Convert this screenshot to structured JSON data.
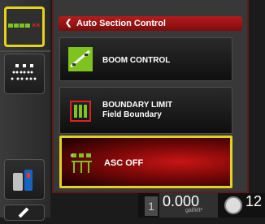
{
  "panel": {
    "header_title": "Auto Section Control",
    "header_back_glyph": "❮"
  },
  "menu": {
    "boom_control": "BOOM CONTROL",
    "boundary_limit": "BOUNDARY LIMIT",
    "boundary_field": "Field Boundary",
    "asc_off": "ASC OFF"
  },
  "status": {
    "section_count": "1",
    "rate_value": "0.000",
    "rate_unit": "gal/kft²",
    "speed_value": "12"
  },
  "colors": {
    "highlight": "#e6d21a",
    "header_red": "#b61c1c",
    "section_green": "#7fc31f"
  },
  "icons": [
    "sections-icon",
    "sprayer-nozzles-icon",
    "tools-icon",
    "back-arrow-icon",
    "boom-control-icon",
    "boundary-limit-icon",
    "asc-icon",
    "speed-gauge-icon"
  ]
}
